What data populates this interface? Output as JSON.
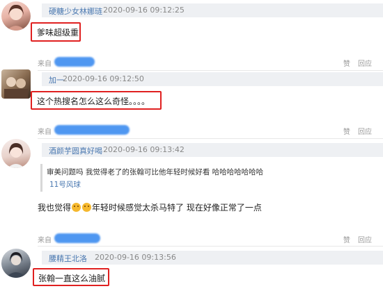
{
  "comments": [
    {
      "username": "硬糖少女林娜琏",
      "timestamp": "2020-09-16 09:12:25",
      "text": "爹味超级重",
      "source_label": "来自",
      "actions": [
        "赞",
        "回应"
      ]
    },
    {
      "username": "加一",
      "timestamp": "2020-09-16 09:12:50",
      "text": "这个热搜名怎么这么奇怪。。。。",
      "source_label": "来自",
      "actions": [
        "赞",
        "回应"
      ]
    },
    {
      "username": "酒颜芋圆真好喝",
      "timestamp": "2020-09-16 09:13:42",
      "quote_text": "审美问题吗 我觉得老了的张翰可比他年轻时候好看 哈哈哈哈哈哈哈",
      "quote_author": "11号风球",
      "text_before": "我也觉得",
      "text_after": "年轻时候感觉太杀马特了 现在好像正常了一点",
      "source_label": "来自",
      "actions": [
        "赞",
        "回应"
      ]
    },
    {
      "username": "腰精王北洛",
      "timestamp": "2020-09-16 09:13:56",
      "text": "张翰一直这么油腻"
    }
  ],
  "icons": {
    "emoji": "grinning-face-icon"
  }
}
